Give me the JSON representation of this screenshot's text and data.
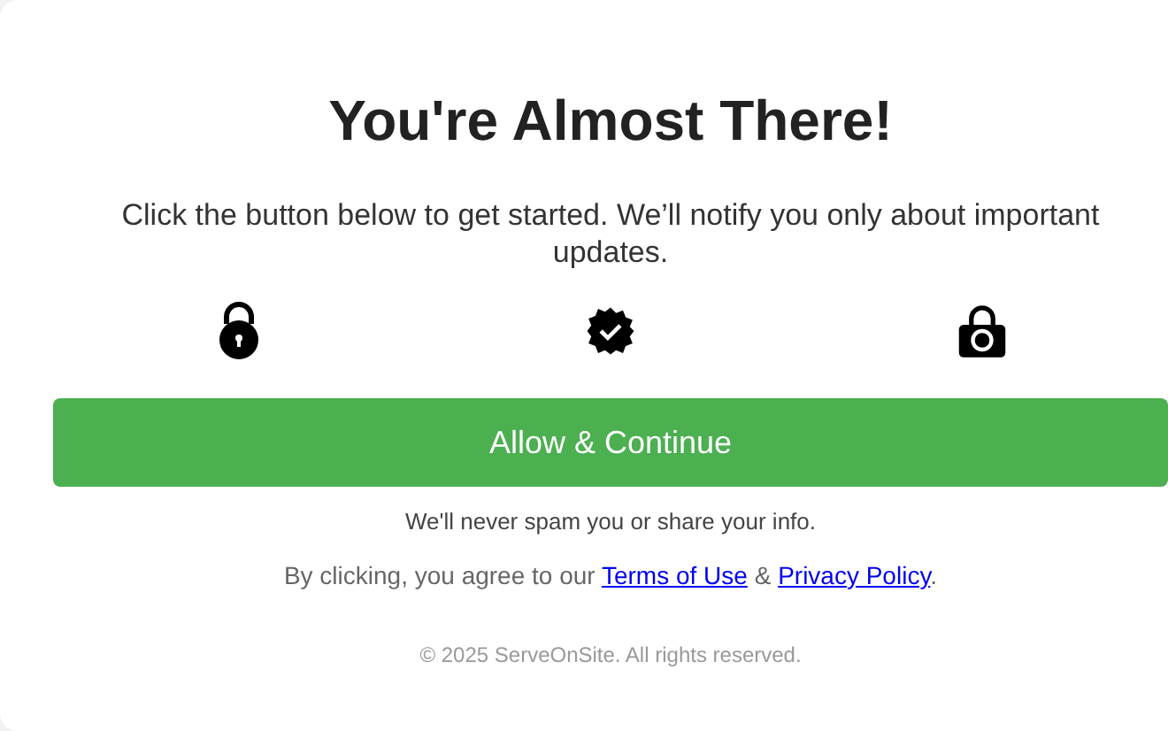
{
  "title": "You're Almost There!",
  "subtitle": "Click the button below to get started. We’ll notify you only about important updates.",
  "button": "Allow & Continue",
  "note": "We'll never spam you or share your info.",
  "consent": {
    "before": "By clicking, you agree to our ",
    "links": [
      "Terms of Use",
      "Privacy Policy"
    ],
    "between": " & ",
    "after": "."
  },
  "footer": "© 2025 ServeOnSite. All rights reserved."
}
